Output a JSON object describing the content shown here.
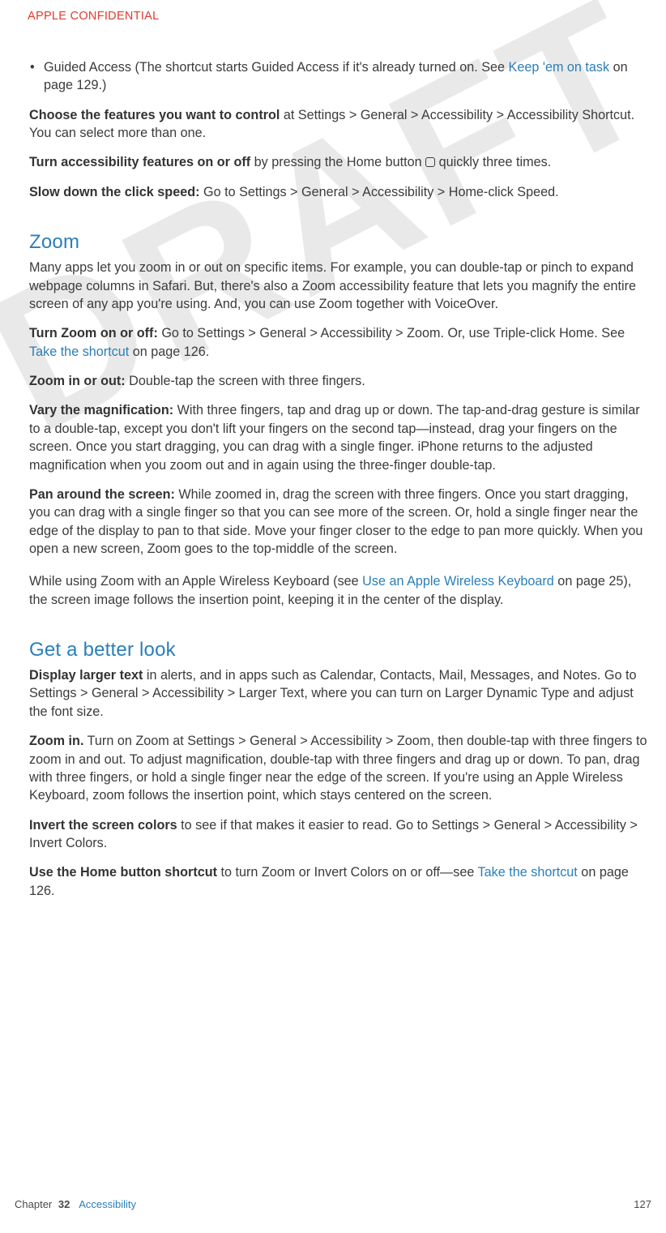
{
  "header": {
    "confidential": "APPLE CONFIDENTIAL"
  },
  "watermark": "DRAFT",
  "body": {
    "bullet1_a": "Guided Access (The shortcut starts Guided Access if it's already turned on. See ",
    "bullet1_link": "Keep 'em on task",
    "bullet1_b": " on page 129.)",
    "p1_bold": "Choose the features you want to control",
    "p1_rest": " at Settings > General > Accessibility > Accessibility Shortcut. You can select more than one.",
    "p2_bold": "Turn accessibility features on or off",
    "p2_a": " by pressing the Home button ",
    "p2_b": " quickly three times.",
    "p3_bold": "Slow down the click speed:",
    "p3_rest": "  Go to Settings > General > Accessibility > Home-click Speed.",
    "h_zoom": "Zoom",
    "zoom_intro": "Many apps let you zoom in or out on specific items. For example, you can double-tap or pinch to expand webpage columns in Safari. But, there's also a Zoom accessibility feature that lets you magnify the entire screen of any app you're using. And, you can use Zoom together with VoiceOver.",
    "zoom_on_bold": "Turn Zoom on or off:",
    "zoom_on_a": "  Go to Settings > General > Accessibility > Zoom. Or, use Triple-click Home. See ",
    "zoom_on_link": "Take the shortcut",
    "zoom_on_b": " on page 126.",
    "zoom_inout_bold": "Zoom in or out:",
    "zoom_inout_rest": "  Double-tap the screen with three fingers.",
    "vary_bold": "Vary the magnification:",
    "vary_rest": "  With three fingers, tap and drag up or down. The tap-and-drag gesture is similar to a double-tap, except you don't lift your fingers on the second tap—instead, drag your fingers on the screen. Once you start dragging, you can drag with a single finger. iPhone returns to the adjusted magnification when you zoom out and in again using the three-finger double-tap.",
    "pan_bold": "Pan around the screen:",
    "pan_rest": "  While zoomed in, drag the screen with three fingers. Once you start dragging, you can drag with a single finger so that you can see more of the screen. Or, hold a single finger near the edge of the display to pan to that side. Move your finger closer to the edge to pan more quickly. When you open a new screen, Zoom goes to the top-middle of the screen.",
    "zoom_kb_a": "While using Zoom with an Apple Wireless Keyboard (see ",
    "zoom_kb_link": "Use an Apple Wireless Keyboard",
    "zoom_kb_b": " on page 25), the screen image follows the insertion point, keeping it in the center of the display.",
    "h_look": "Get a better look",
    "larger_bold": "Display larger text",
    "larger_rest": " in alerts, and in apps such as Calendar, Contacts, Mail, Messages, and Notes. Go to Settings > General > Accessibility > Larger Text, where you can turn on Larger Dynamic Type and adjust the font size.",
    "zoomin_bold": "Zoom in.",
    "zoomin_rest": " Turn on Zoom at Settings > General > Accessibility > Zoom, then double-tap with three fingers to zoom in and out. To adjust magnification, double-tap with three fingers and drag up or down. To pan, drag with three fingers, or hold a single finger near the edge of the screen. If you're using an Apple Wireless Keyboard, zoom follows the insertion point, which stays centered on the screen.",
    "invert_bold": "Invert the screen colors",
    "invert_rest": " to see if that makes it easier to read. Go to Settings > General > Accessibility > Invert Colors.",
    "homeshort_bold": "Use the Home button shortcut",
    "homeshort_a": " to turn Zoom or Invert Colors on or off—see ",
    "homeshort_link": "Take the shortcut",
    "homeshort_b": " on page 126."
  },
  "footer": {
    "chapter_label": "Chapter",
    "chapter_num": "32",
    "chapter_title": "Accessibility",
    "page_num": "127"
  }
}
